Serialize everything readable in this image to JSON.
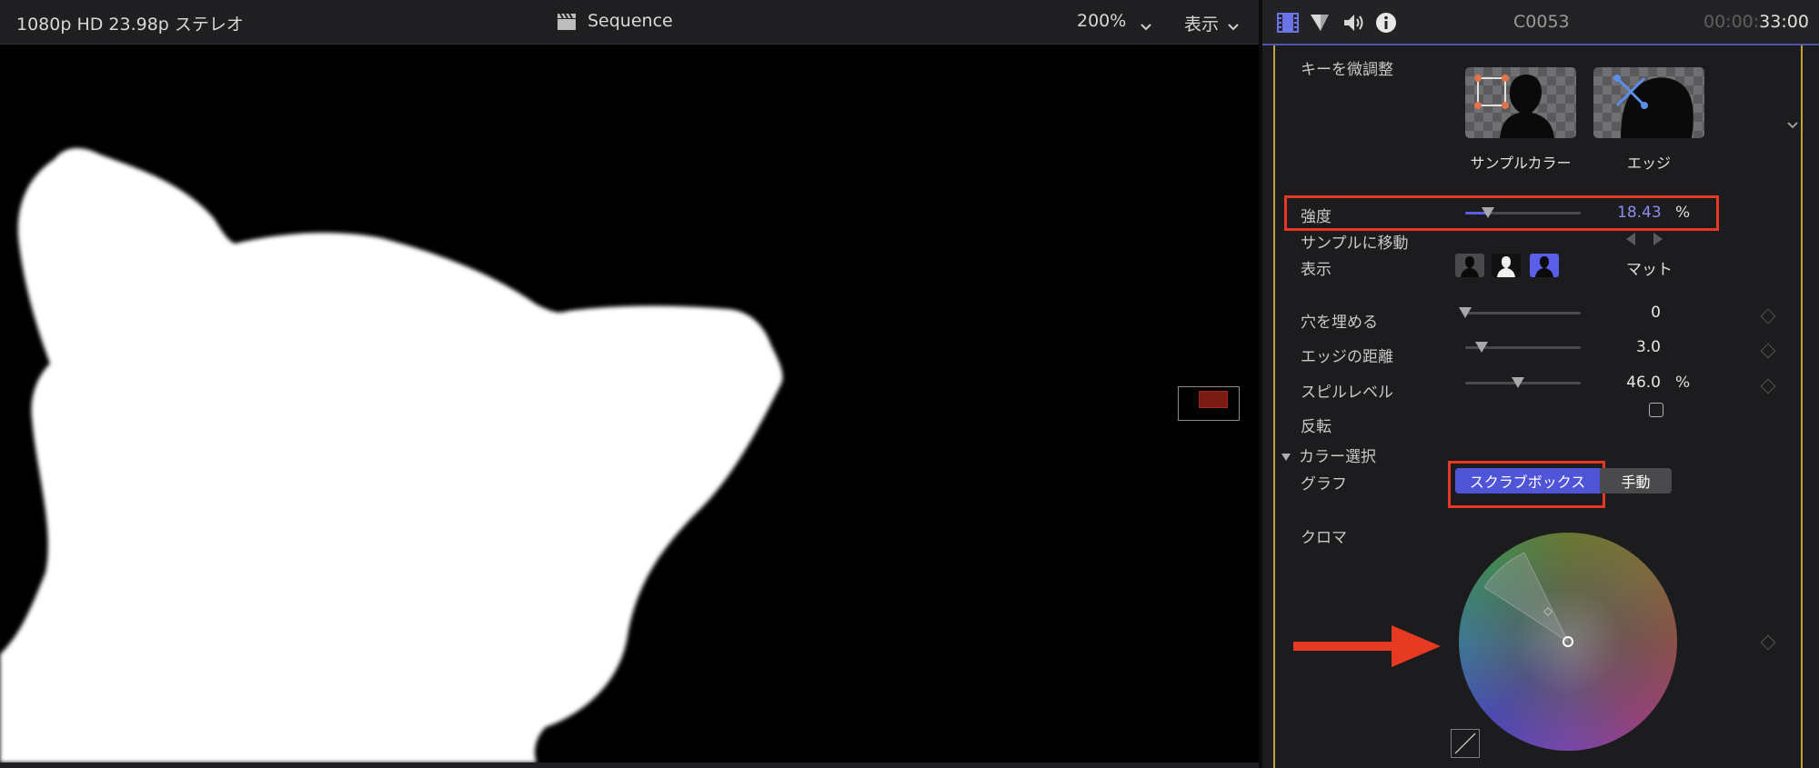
{
  "viewer": {
    "format": "1080p HD 23.98p ステレオ",
    "title": "Sequence",
    "zoom": "200%",
    "view_menu": "表示"
  },
  "inspector": {
    "clip_name": "C0053",
    "timecode_dim": "00:00:",
    "timecode_bright": "33:00",
    "tab_icons": [
      "film-icon",
      "filter-icon",
      "audio-icon",
      "info-icon"
    ],
    "fine_tune": {
      "label": "キーを微調整",
      "sample_color": "サンプルカラー",
      "edge": "エッジ"
    },
    "strength": {
      "label": "強度",
      "value": "18.43",
      "unit": "%",
      "fraction": 0.2
    },
    "go_to_sample": {
      "label": "サンプルに移動"
    },
    "view": {
      "label": "表示",
      "mode": "マット"
    },
    "fill_holes": {
      "label": "穴を埋める",
      "value": "0",
      "fraction": 0.0
    },
    "edge_distance": {
      "label": "エッジの距離",
      "value": "3.0",
      "fraction": 0.14
    },
    "spill_level": {
      "label": "スピルレベル",
      "value": "46.0",
      "unit": "%",
      "fraction": 0.46
    },
    "invert": {
      "label": "反転",
      "checked": false
    },
    "color_selection": {
      "label": "カラー選択"
    },
    "graph": {
      "label": "グラフ",
      "scrub_box": "スクラブボックス",
      "manual": "手動"
    },
    "chroma": {
      "label": "クロマ"
    }
  },
  "colors": {
    "accent": "#4e54b0",
    "highlight_red": "#e63a22",
    "guide_gold": "#c7a23c",
    "value_blue": "#8c8cf0"
  }
}
